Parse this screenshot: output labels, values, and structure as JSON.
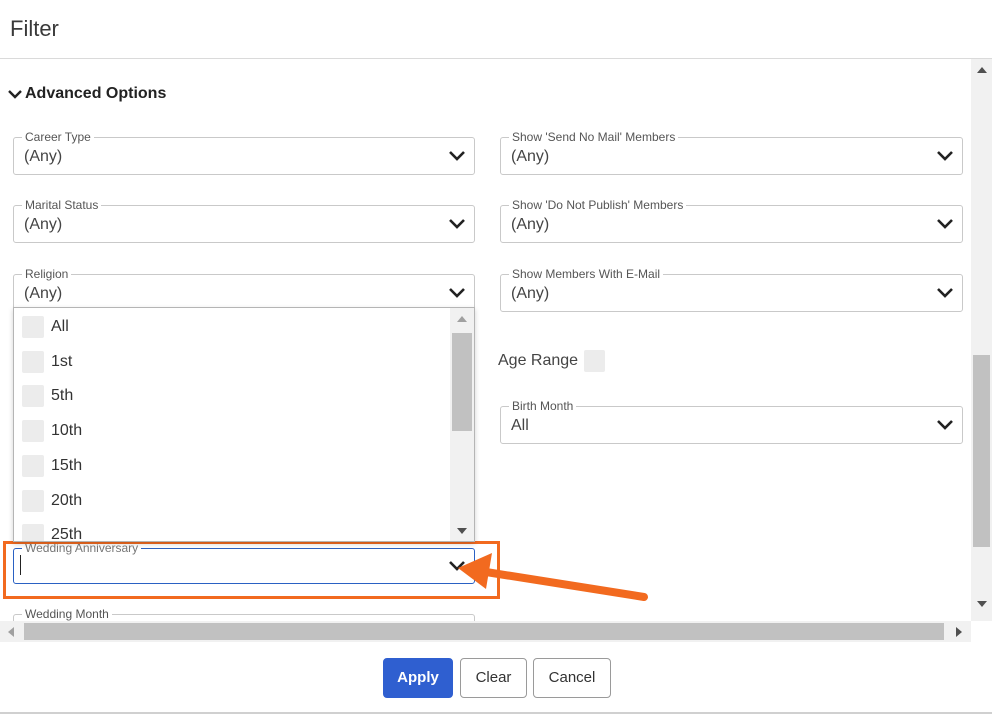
{
  "dialog": {
    "title": "Filter"
  },
  "advanced": {
    "heading": "Advanced Options"
  },
  "fields": {
    "career_type": {
      "label": "Career Type",
      "value": "(Any)"
    },
    "send_no_mail": {
      "label": "Show 'Send No Mail' Members",
      "value": "(Any)"
    },
    "marital_status": {
      "label": "Marital Status",
      "value": "(Any)"
    },
    "do_not_publish": {
      "label": "Show 'Do Not Publish' Members",
      "value": "(Any)"
    },
    "religion": {
      "label": "Religion",
      "value": "(Any)"
    },
    "with_email": {
      "label": "Show Members With E-Mail",
      "value": "(Any)"
    },
    "age_range": {
      "label": "Age Range"
    },
    "birth_month": {
      "label": "Birth Month",
      "value": "All"
    },
    "wedding_anniversary": {
      "label": "Wedding Anniversary",
      "value": ""
    },
    "wedding_month": {
      "label": "Wedding Month"
    }
  },
  "anniversary_options": [
    "All",
    "1st",
    "5th",
    "10th",
    "15th",
    "20th",
    "25th"
  ],
  "footer": {
    "apply": "Apply",
    "clear": "Clear",
    "cancel": "Cancel"
  },
  "colors": {
    "accent": "#2f5fd0",
    "highlight": "#f26a1f"
  },
  "icons": {
    "chevron": "chevron-down-icon",
    "arrow": "annotation-arrow-icon"
  }
}
